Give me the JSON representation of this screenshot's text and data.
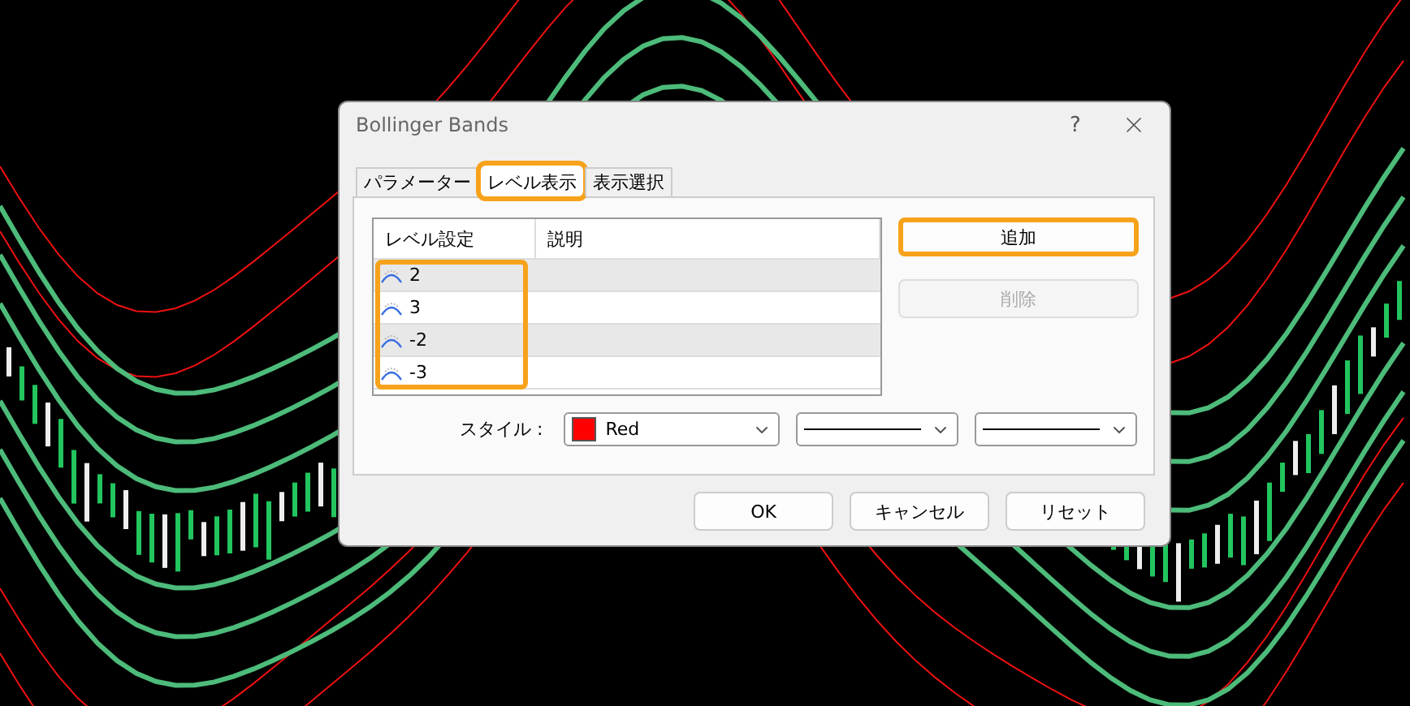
{
  "window": {
    "title": "Bollinger Bands",
    "help": "?"
  },
  "tabs": [
    {
      "label": "パラメーター",
      "selected": false,
      "highlighted": false
    },
    {
      "label": "レベル表示",
      "selected": true,
      "highlighted": true
    },
    {
      "label": "表示選択",
      "selected": false,
      "highlighted": false
    }
  ],
  "table": {
    "columns": [
      "レベル設定",
      "説明"
    ],
    "values_highlighted": true,
    "rows": [
      {
        "value": "2"
      },
      {
        "value": "3"
      },
      {
        "value": "-2"
      },
      {
        "value": "-3"
      }
    ]
  },
  "side_buttons": [
    {
      "label": "追加",
      "disabled": false,
      "highlighted": true
    },
    {
      "label": "削除",
      "disabled": true,
      "highlighted": false
    }
  ],
  "style": {
    "label": "スタイル :",
    "selects": [
      {
        "kind": "color",
        "text": "Red",
        "color": "#ff0000"
      },
      {
        "kind": "line"
      },
      {
        "kind": "line"
      }
    ]
  },
  "buttons": [
    "OK",
    "キャンセル",
    "リセット"
  ]
}
